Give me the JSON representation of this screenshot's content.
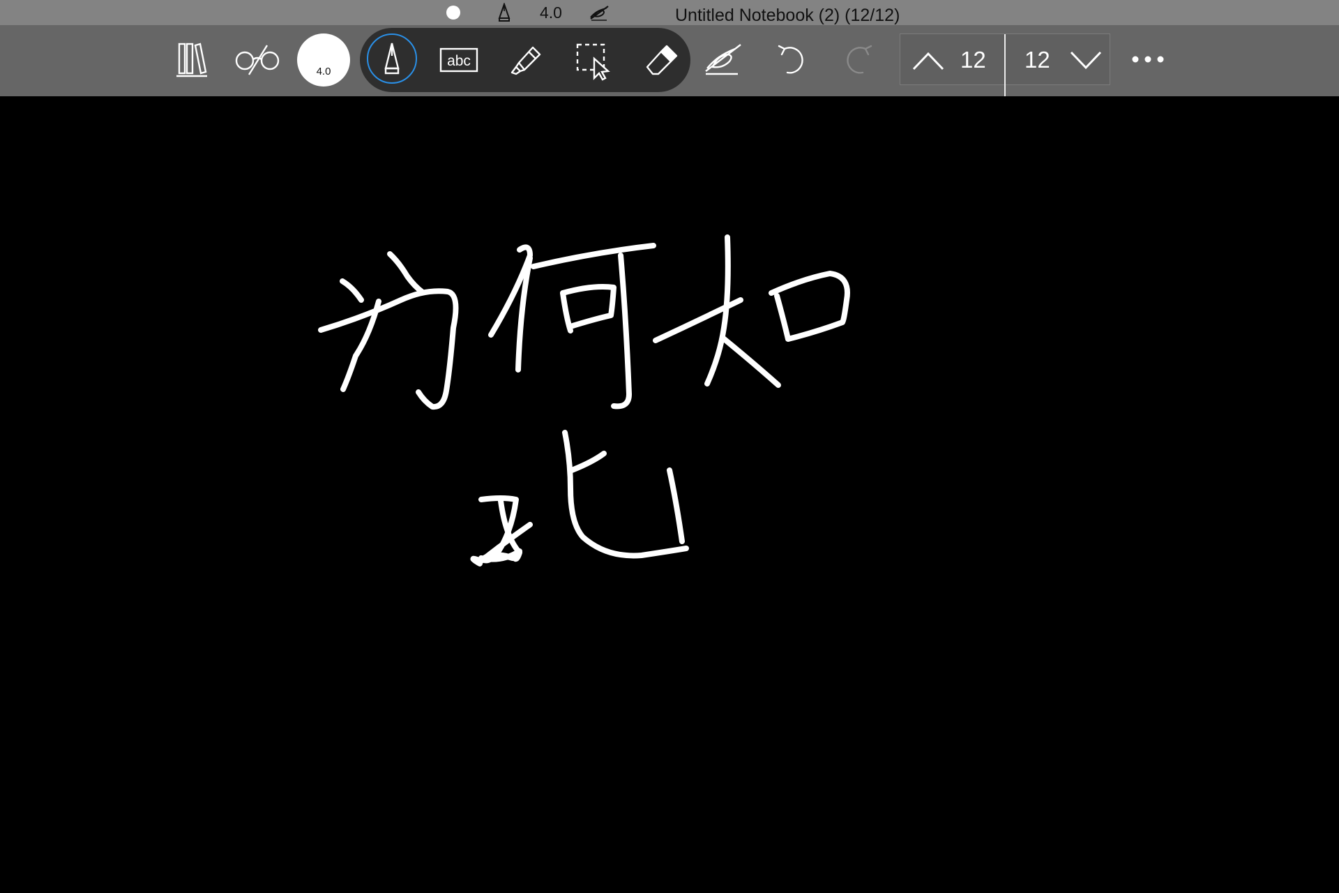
{
  "window": {
    "title": "Untitled Notebook (2) (12/12)"
  },
  "status": {
    "pen_size": "4.0"
  },
  "toolbar": {
    "library_icon": "library-books-icon",
    "view_icon": "glasses-icon",
    "pen_size_label": "4.0",
    "tools": [
      "pen",
      "text",
      "highlighter",
      "lasso-select",
      "eraser"
    ],
    "selected_tool": "pen",
    "accent_color": "#2a90e8",
    "page_nav": {
      "previous_page": "12",
      "next_page": "12"
    }
  },
  "canvas": {
    "background": "#000000",
    "ink_color": "#ffffff",
    "handwritten_text": "为何如此"
  }
}
